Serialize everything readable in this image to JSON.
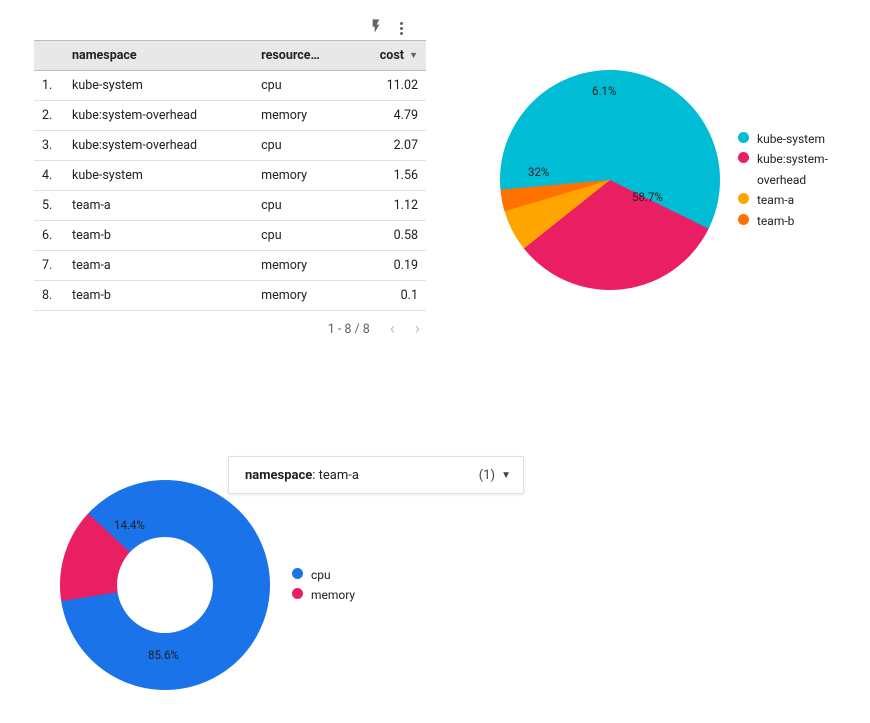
{
  "toolbar": {
    "lightning_label": "lightning-icon",
    "menu_label": "more-menu-icon"
  },
  "table": {
    "headers": {
      "index": "",
      "namespace": "namespace",
      "resource": "resource…",
      "cost": "cost"
    },
    "rows": [
      {
        "idx": "1.",
        "namespace": "kube-system",
        "resource": "cpu",
        "cost": "11.02"
      },
      {
        "idx": "2.",
        "namespace": "kube:system-overhead",
        "resource": "memory",
        "cost": "4.79"
      },
      {
        "idx": "3.",
        "namespace": "kube:system-overhead",
        "resource": "cpu",
        "cost": "2.07"
      },
      {
        "idx": "4.",
        "namespace": "kube-system",
        "resource": "memory",
        "cost": "1.56"
      },
      {
        "idx": "5.",
        "namespace": "team-a",
        "resource": "cpu",
        "cost": "1.12"
      },
      {
        "idx": "6.",
        "namespace": "team-b",
        "resource": "cpu",
        "cost": "0.58"
      },
      {
        "idx": "7.",
        "namespace": "team-a",
        "resource": "memory",
        "cost": "0.19"
      },
      {
        "idx": "8.",
        "namespace": "team-b",
        "resource": "memory",
        "cost": "0.1"
      }
    ],
    "pager": {
      "range": "1 - 8 / 8",
      "prev": "‹",
      "next": "›"
    }
  },
  "pie": {
    "labels": {
      "slice1": "58.7%",
      "slice2": "32%",
      "slice3": "6.1%"
    },
    "legend": [
      {
        "color": "#00bcd4",
        "label": "kube-system"
      },
      {
        "color": "#e91e63",
        "label": "kube:system-overhead"
      },
      {
        "color": "#ffa500",
        "label": "team-a"
      },
      {
        "color": "#ff7200",
        "label": "team-b"
      }
    ]
  },
  "filter": {
    "key": "namespace",
    "value": ": team-a",
    "count": "(1)"
  },
  "donut": {
    "labels": {
      "slice1": "85.6%",
      "slice2": "14.4%"
    },
    "legend": [
      {
        "color": "#1a73e8",
        "label": "cpu"
      },
      {
        "color": "#e91e63",
        "label": "memory"
      }
    ]
  },
  "chart_data": [
    {
      "type": "table",
      "columns": [
        "namespace",
        "resource",
        "cost"
      ],
      "rows": [
        [
          "kube-system",
          "cpu",
          11.02
        ],
        [
          "kube:system-overhead",
          "memory",
          4.79
        ],
        [
          "kube:system-overhead",
          "cpu",
          2.07
        ],
        [
          "kube-system",
          "memory",
          1.56
        ],
        [
          "team-a",
          "cpu",
          1.12
        ],
        [
          "team-b",
          "cpu",
          0.58
        ],
        [
          "team-a",
          "memory",
          0.19
        ],
        [
          "team-b",
          "memory",
          0.1
        ]
      ]
    },
    {
      "type": "pie",
      "title": "",
      "categories": [
        "kube-system",
        "kube:system-overhead",
        "team-a",
        "team-b"
      ],
      "values": [
        58.7,
        32.0,
        6.1,
        3.2
      ],
      "colors": [
        "#00bcd4",
        "#e91e63",
        "#ffa500",
        "#ff7200"
      ]
    },
    {
      "type": "pie",
      "title": "namespace: team-a",
      "categories": [
        "cpu",
        "memory"
      ],
      "values": [
        85.6,
        14.4
      ],
      "colors": [
        "#1a73e8",
        "#e91e63"
      ],
      "donut": true
    }
  ]
}
